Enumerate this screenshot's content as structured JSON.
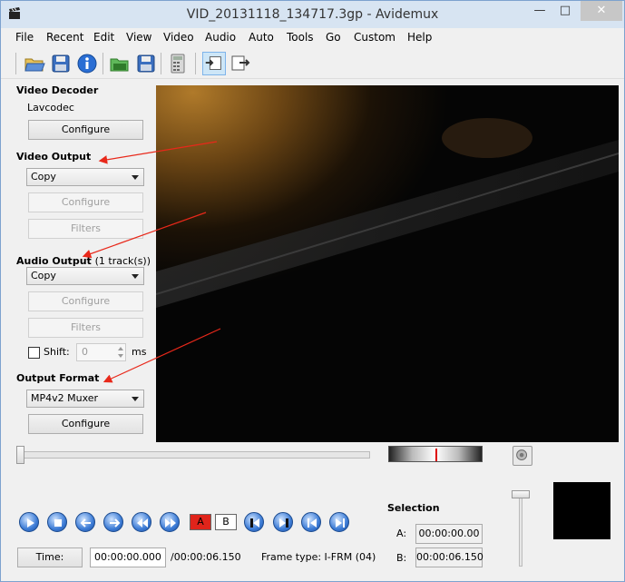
{
  "window": {
    "title": "VID_20131118_134717.3gp - Avidemux",
    "minimize_glyph": "—",
    "maximize_glyph": "□",
    "close_glyph": "✕"
  },
  "menu": [
    "File",
    "Recent",
    "Edit",
    "View",
    "Video",
    "Audio",
    "Auto",
    "Tools",
    "Go",
    "Custom",
    "Help"
  ],
  "toolbar": {
    "icons": [
      "open-folder-icon",
      "save-icon",
      "info-icon",
      "open-video-icon",
      "save-video-icon",
      "calculator-icon",
      "input-preview-icon",
      "output-preview-icon"
    ]
  },
  "left_panel": {
    "video_decoder": {
      "title": "Video Decoder",
      "decoder_name": "Lavcodec",
      "configure_label": "Configure"
    },
    "video_output": {
      "title": "Video Output",
      "selected": "Copy",
      "configure_label": "Configure",
      "filters_label": "Filters"
    },
    "audio_output": {
      "title": "Audio Output",
      "tracks": "(1 track(s))",
      "selected": "Copy",
      "configure_label": "Configure",
      "filters_label": "Filters",
      "shift_label": "Shift:",
      "shift_value": "0",
      "shift_unit": "ms"
    },
    "output_format": {
      "title": "Output Format",
      "selected": "MP4v2 Muxer",
      "configure_label": "Configure"
    }
  },
  "playback": {
    "marker_a_label": "A",
    "marker_b_label": "B",
    "time_button_label": "Time:",
    "current_time": "00:00:00.000",
    "total_time": "/00:00:06.150",
    "frame_type": "Frame type:  I-FRM (04)"
  },
  "selection": {
    "title": "Selection",
    "a_label": "A:",
    "a_value": "00:00:00.00",
    "b_label": "B:",
    "b_value": "00:00:06.150"
  },
  "colors": {
    "titlebar_bg": "#d7e4f2",
    "annotation_arrow": "#e8281a",
    "marker_a_fill": "#e0241b"
  }
}
